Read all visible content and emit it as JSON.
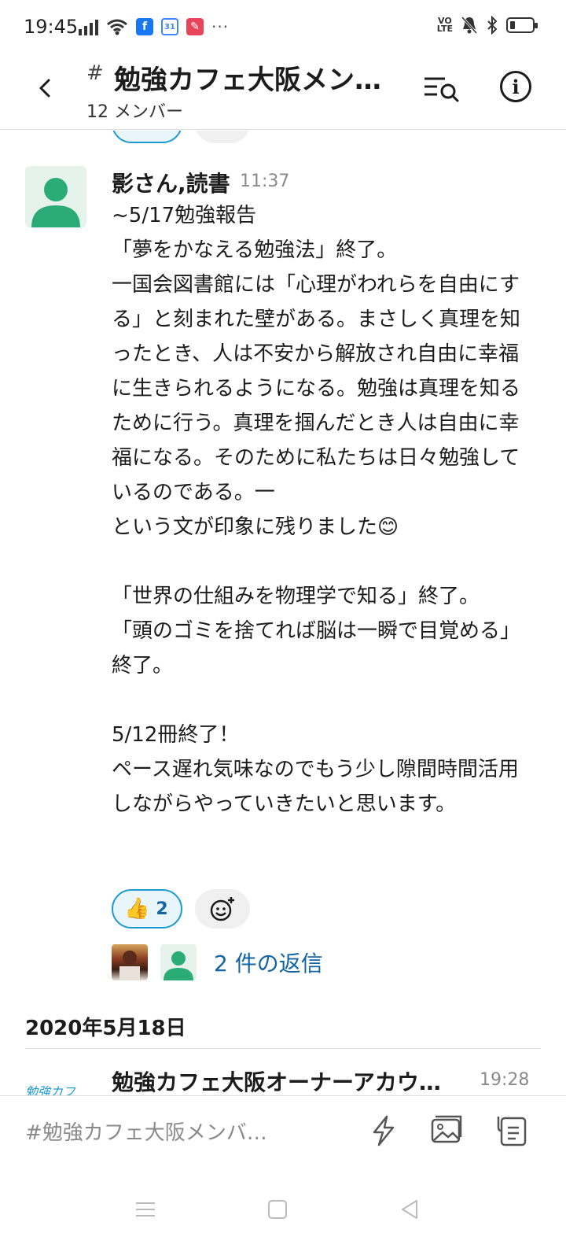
{
  "status_bar": {
    "time": "19:45",
    "dots": "···",
    "volte_top": "VO",
    "volte_bottom": "LTE",
    "app_icons": [
      "facebook-icon",
      "calendar-icon",
      "pin-icon"
    ]
  },
  "header": {
    "hash": "#",
    "title": "勉強カフェ大阪メン…",
    "subtitle": "12 メンバー"
  },
  "message": {
    "author": "影さん,読書",
    "time": "11:37",
    "body": "~5/17勉強報告\n「夢をかなえる勉強法」終了。\n一国会図書館には「心理がわれらを自由にする」と刻まれた壁がある。まさしく真理を知ったとき、人は不安から解放され自由に幸福に生きられるようになる。勉強は真理を知るために行う。真理を掴んだとき人は自由に幸福になる。そのために私たちは日々勉強しているのである。一\nという文が印象に残りました😊\n\n「世界の仕組みを物理学で知る」終了。\n「頭のゴミを捨てれば脳は一瞬で目覚める」終了。\n\n5/12冊終了！\nペース遅れ気味なのでもう少し隙間時間活用しながらやっていきたいと思います。",
    "reaction": {
      "emoji": "👍",
      "count": "2"
    },
    "replies_label": "2 件の返信"
  },
  "date_divider": "2020年5月18日",
  "next_message": {
    "author": "勉強カフェ大阪オーナーアカウ…",
    "time": "19:28",
    "avatar_text": "勉強カフ"
  },
  "composer": {
    "placeholder": "#勉強カフェ大阪メンバ…"
  },
  "colors": {
    "accent": "#1d9bd1",
    "link": "#1264a3",
    "avatar_green": "#2bac76"
  }
}
